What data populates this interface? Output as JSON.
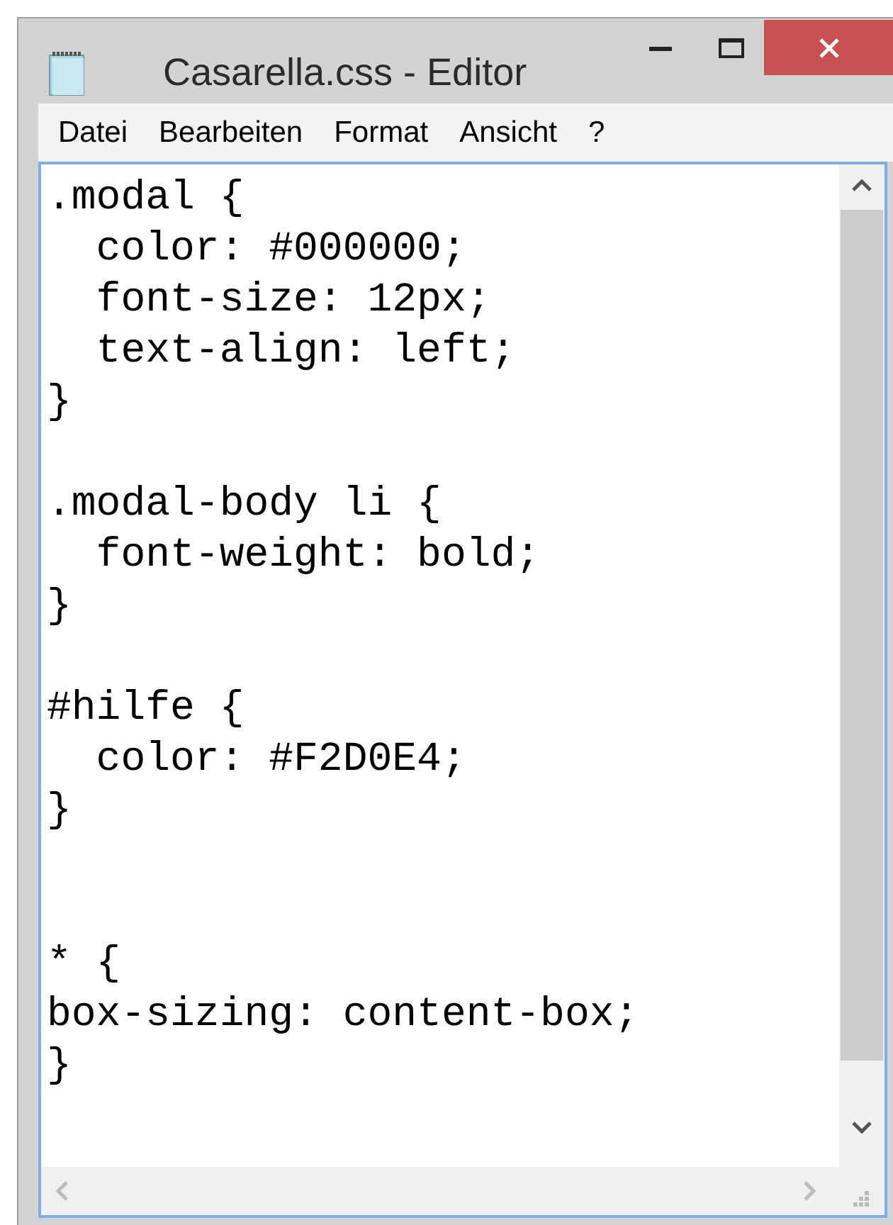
{
  "window": {
    "title": "Casarella.css - Editor"
  },
  "menu": [
    "Datei",
    "Bearbeiten",
    "Format",
    "Ansicht",
    "?"
  ],
  "editor": {
    "text": ".modal {\n  color: #000000;\n  font-size: 12px;\n  text-align: left;\n}\n\n.modal-body li {\n  font-weight: bold;\n}\n\n#hilfe {\n  color: #F2D0E4;\n}\n\n\n* {\nbox-sizing: content-box;\n}"
  }
}
